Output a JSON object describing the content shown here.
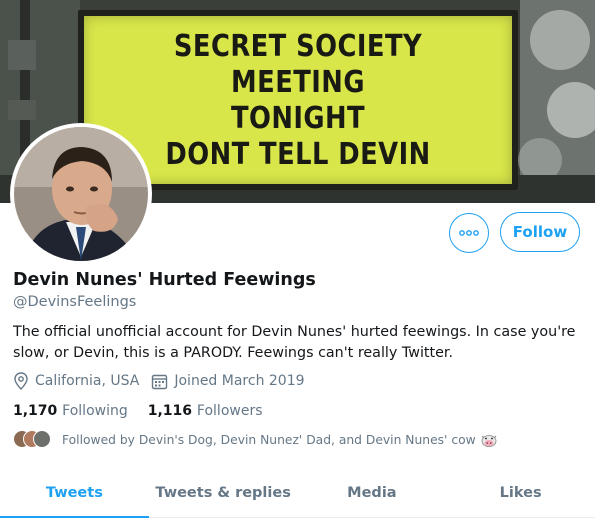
{
  "banner": {
    "sign_lines": [
      "SECRET SOCIETY",
      "MEETING",
      "TONIGHT",
      "DONT TELL DEVIN"
    ]
  },
  "profile": {
    "display_name": "Devin Nunes' Hurted Feewings",
    "handle": "@DevinsFeelings",
    "bio": "The official unofficial account for Devin Nunes' hurted feewings. In case you're slow, or Devin, this is a PARODY. Feewings can't really Twitter.",
    "location": "California, USA",
    "joined": "Joined March 2019"
  },
  "actions": {
    "more_icon": "more-dots-icon",
    "follow_label": "Follow"
  },
  "stats": {
    "following_count": "1,170",
    "following_label": "Following",
    "followers_count": "1,116",
    "followers_label": "Followers"
  },
  "followed_by": {
    "text": "Followed by Devin's Dog, Devin Nunez' Dad, and Devin Nunes' cow"
  },
  "tabs": [
    {
      "label": "Tweets",
      "active": true
    },
    {
      "label": "Tweets & replies",
      "active": false
    },
    {
      "label": "Media",
      "active": false
    },
    {
      "label": "Likes",
      "active": false
    }
  ],
  "colors": {
    "accent": "#1da1f2",
    "secondary_text": "#657786",
    "sign_yellow": "#d8e64a"
  }
}
